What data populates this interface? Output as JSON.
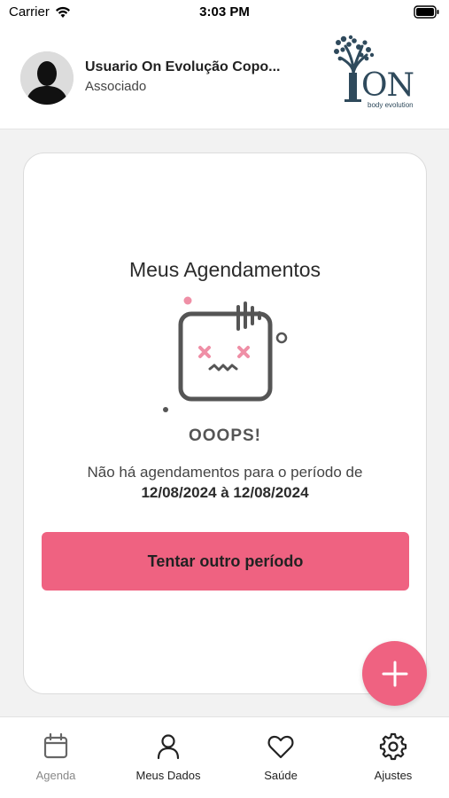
{
  "status_bar": {
    "carrier": "Carrier",
    "time": "3:03 PM"
  },
  "header": {
    "user_name": "Usuario On Evolução Copo...",
    "user_role": "Associado",
    "brand_name": "ON",
    "brand_tagline": "body evolution"
  },
  "card": {
    "title": "Meus Agendamentos",
    "oops": "OOOPS!",
    "empty_message": "Não há agendamentos para o período de",
    "period": "12/08/2024 à 12/08/2024",
    "retry_label": "Tentar outro período"
  },
  "fab": {
    "icon": "plus-icon"
  },
  "tabs": [
    {
      "label": "Agenda",
      "icon": "calendar-icon",
      "active": false
    },
    {
      "label": "Meus Dados",
      "icon": "user-icon",
      "active": true
    },
    {
      "label": "Saúde",
      "icon": "heart-icon",
      "active": true
    },
    {
      "label": "Ajustes",
      "icon": "gear-icon",
      "active": true
    }
  ],
  "colors": {
    "accent": "#ef6281",
    "brand": "#2f4a5c",
    "background": "#f2f2f2"
  }
}
